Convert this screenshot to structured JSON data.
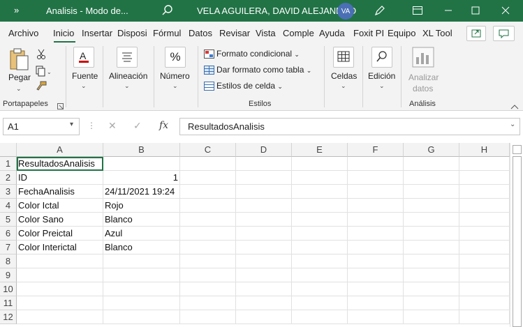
{
  "titlebar": {
    "chevrons": "»",
    "title": "Analisis  -  Modo de...",
    "user_name": "VELA AGUILERA, DAVID ALEJANDRO",
    "avatar_initials": "VA",
    "accent_color": "#217346"
  },
  "tabs": [
    {
      "label": "Archivo"
    },
    {
      "label": "Inicio"
    },
    {
      "label": "Insertar"
    },
    {
      "label": "Disposi"
    },
    {
      "label": "Fórmul"
    },
    {
      "label": "Datos"
    },
    {
      "label": "Revisar"
    },
    {
      "label": "Vista"
    },
    {
      "label": "Comple"
    },
    {
      "label": "Ayuda"
    },
    {
      "label": "Foxit PI"
    },
    {
      "label": "Equipo"
    },
    {
      "label": "XL Tool"
    }
  ],
  "ribbon": {
    "paste_label": "Pegar",
    "clipboard_group": "Portapapeles",
    "font_label": "Fuente",
    "alignment_label": "Alineación",
    "number_label": "Número",
    "conditional_format": "Formato condicional",
    "format_as_table": "Dar formato como tabla",
    "cell_styles": "Estilos de celda",
    "styles_group": "Estilos",
    "cells_label": "Celdas",
    "editing_label": "Edición",
    "analyze_label_1": "Analizar",
    "analyze_label_2": "datos",
    "analysis_group": "Análisis"
  },
  "formula_bar": {
    "name_box": "A1",
    "formula_value": "ResultadosAnalisis"
  },
  "grid": {
    "columns": [
      "A",
      "B",
      "C",
      "D",
      "E",
      "F",
      "G",
      "H"
    ],
    "rows": [
      "1",
      "2",
      "3",
      "4",
      "5",
      "6",
      "7",
      "8",
      "9",
      "10",
      "11",
      "12"
    ],
    "cells": {
      "A1": "ResultadosAnalisis",
      "A2": "ID",
      "B2": "1",
      "A3": "FechaAnalisis",
      "B3": "24/11/2021 19:24",
      "A4": "Color Ictal",
      "B4": "Rojo",
      "A5": "Color Sano",
      "B5": "Blanco",
      "A6": "Color Preictal",
      "B6": "Azul",
      "A7": "Color Interictal",
      "B7": "Blanco"
    }
  }
}
